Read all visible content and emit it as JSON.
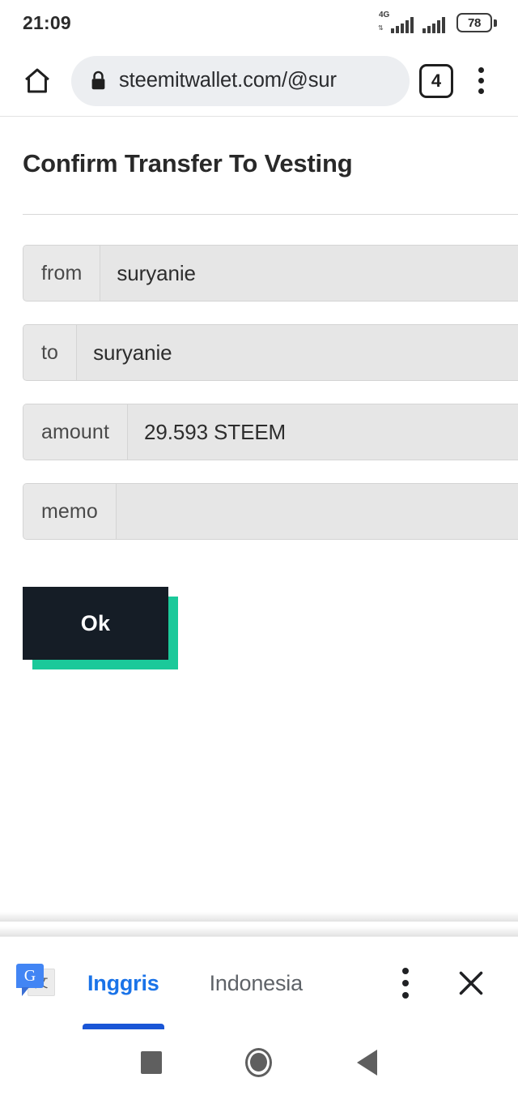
{
  "status_bar": {
    "time": "21:09",
    "network_type": "4G",
    "battery_percent": "78",
    "signal_icon": "signal-bars-icon",
    "battery_icon": "battery-icon"
  },
  "browser": {
    "home_icon": "home-icon",
    "lock_icon": "lock-icon",
    "url": "steemitwallet.com/@sur",
    "tab_count": "4",
    "menu_icon": "kebab-menu-icon"
  },
  "page": {
    "title": "Confirm Transfer To Vesting",
    "rows": [
      {
        "label": "from",
        "value": "suryanie"
      },
      {
        "label": "to",
        "value": "suryanie"
      },
      {
        "label": "amount",
        "value": "29.593 STEEM"
      },
      {
        "label": "memo",
        "value": ""
      }
    ],
    "confirm_button": {
      "label": "Ok",
      "bg_color": "#151d26",
      "shadow_color": "#1bc99a",
      "text_color": "#ffffff"
    }
  },
  "translate_bar": {
    "icon": "google-translate-icon",
    "icon_letter": "G",
    "icon_glyph": "文",
    "source_language": "Inggris",
    "target_language": "Indonesia",
    "active_language": "Inggris",
    "active_color": "#1a73e8",
    "menu_icon": "kebab-menu-icon",
    "close_icon": "close-icon"
  },
  "nav_bar": {
    "recents_label": "recents",
    "home_label": "home",
    "back_label": "back"
  }
}
